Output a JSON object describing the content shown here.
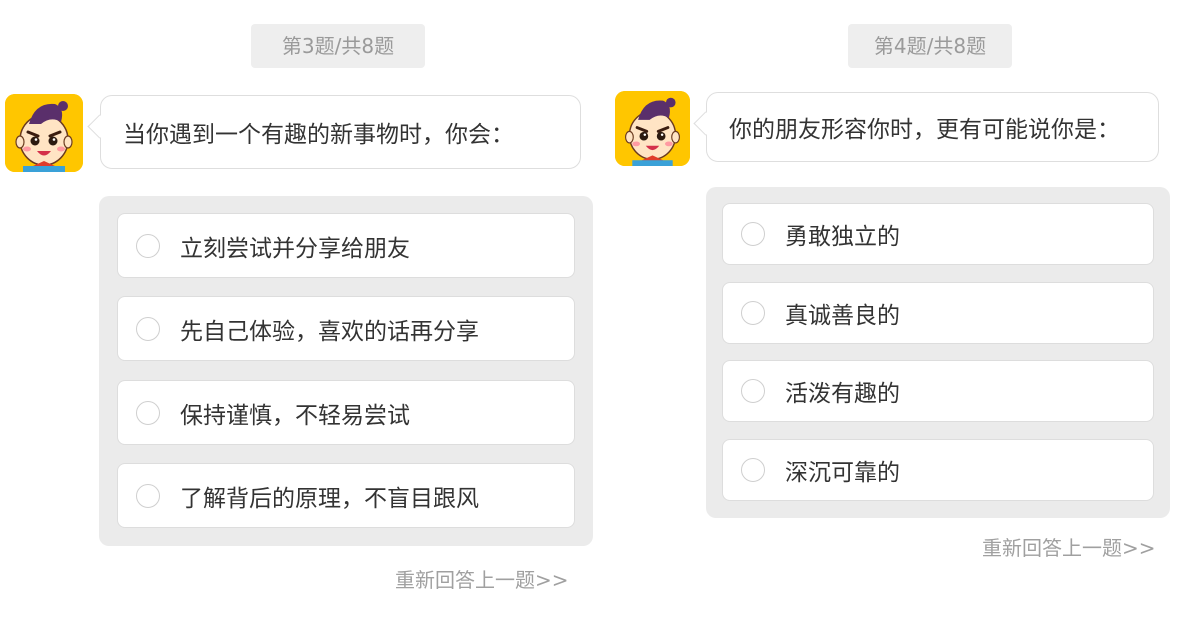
{
  "questions": [
    {
      "counter": "第3题/共8题",
      "prompt": "当你遇到一个有趣的新事物时，你会：",
      "options": [
        {
          "label": "立刻尝试并分享给朋友"
        },
        {
          "label": "先自己体验，喜欢的话再分享"
        },
        {
          "label": "保持谨慎，不轻易尝试"
        },
        {
          "label": "了解背后的原理，不盲目跟风"
        }
      ],
      "retry_label": "重新回答上一题>>"
    },
    {
      "counter": "第4题/共8题",
      "prompt": "你的朋友形容你时，更有可能说你是：",
      "options": [
        {
          "label": "勇敢独立的"
        },
        {
          "label": "真诚善良的"
        },
        {
          "label": "活泼有趣的"
        },
        {
          "label": "深沉可靠的"
        }
      ],
      "retry_label": "重新回答上一题>>"
    }
  ],
  "colors": {
    "avatar_bg": "#ffc600",
    "options_bg": "#ebebeb",
    "muted_text": "#9a9a9a",
    "body_text": "#333333"
  },
  "icons": {
    "avatar": "cartoon-boy-avatar-icon",
    "radio": "radio-unchecked-icon"
  }
}
